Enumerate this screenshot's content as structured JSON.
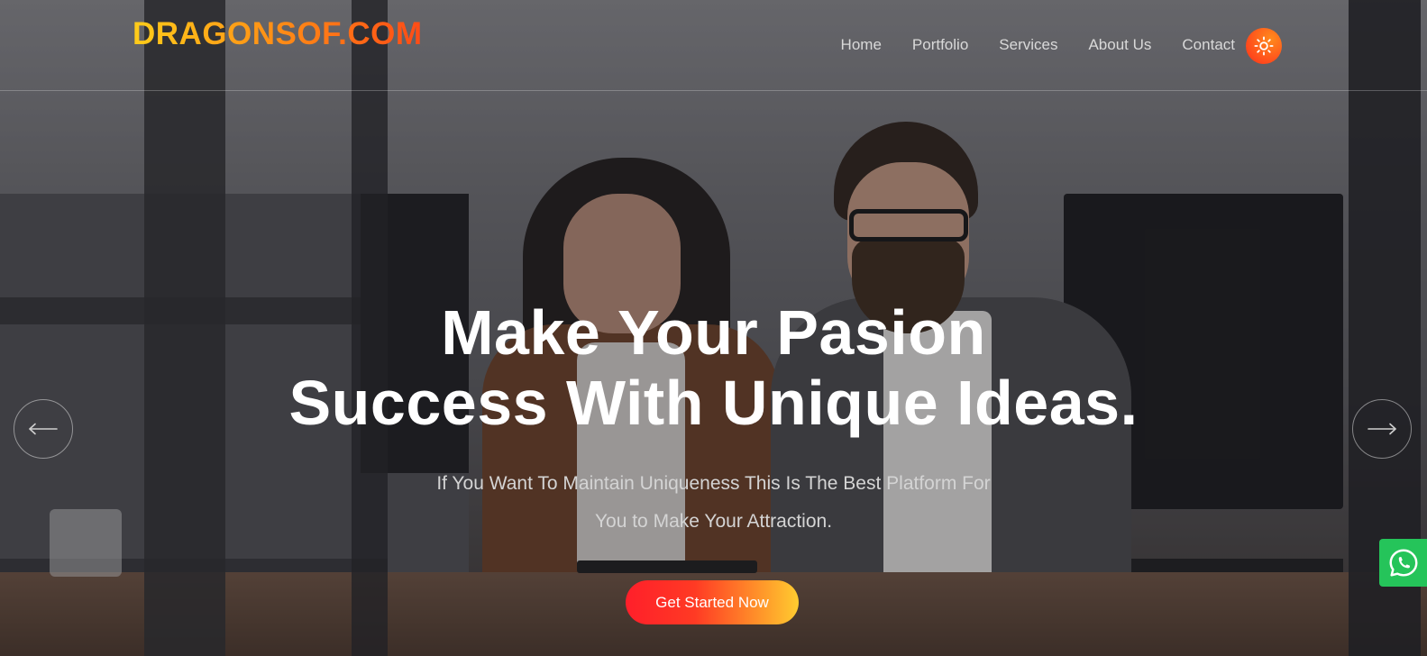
{
  "brand": {
    "logo_text": "DRAGONSOF.COM"
  },
  "nav": {
    "items": [
      {
        "label": "Home"
      },
      {
        "label": "Portfolio"
      },
      {
        "label": "Services"
      },
      {
        "label": "About Us"
      },
      {
        "label": "Contact"
      }
    ],
    "theme_toggle_icon": "sun-icon"
  },
  "hero": {
    "headline_line1": "Make Your Pasion",
    "headline_line2": "Success With Unique Ideas.",
    "subtext_line1": "If You Want To Maintain Uniqueness This Is The Best Platform For",
    "subtext_line2": "You to Make Your Attraction.",
    "cta_label": "Get Started Now",
    "prev_icon": "arrow-left-icon",
    "next_icon": "arrow-right-icon"
  },
  "chat": {
    "icon": "whatsapp-icon"
  },
  "colors": {
    "logo_gradient_start": "#ffcc1a",
    "logo_gradient_end": "#ff4b16",
    "cta_gradient_start": "#ff1f2a",
    "cta_gradient_end": "#ffcc30",
    "toggle_bg": "#ff4a1c",
    "chat_bg": "#25c45a"
  }
}
